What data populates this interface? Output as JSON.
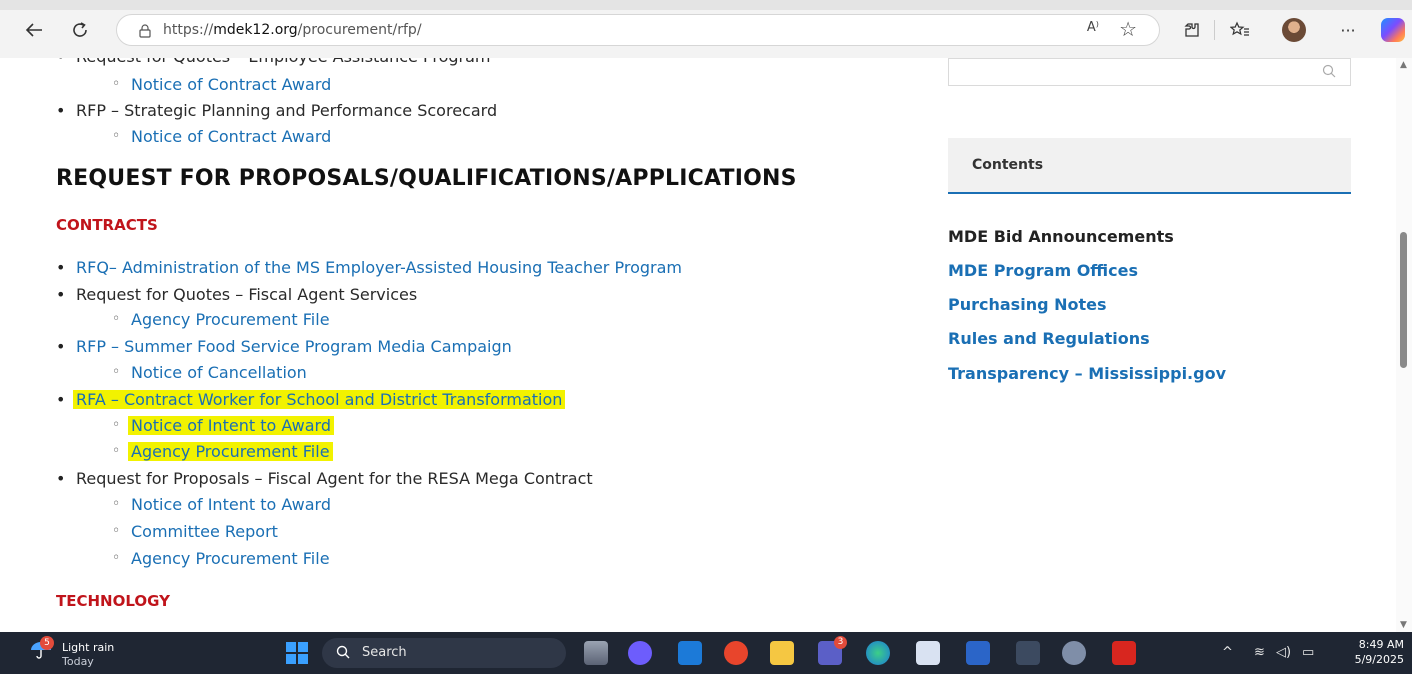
{
  "browser": {
    "url_prefix": "https://",
    "url_domain": "mdek12.org",
    "url_path": "/procurement/rfp/",
    "read_aloud_label": "A⁾"
  },
  "main": {
    "top_items": [
      {
        "title": "Request for Quotes – Employee Assistance Program",
        "sub": [
          "Notice of Contract Award"
        ]
      },
      {
        "title": "RFP – Strategic Planning and Performance Scorecard",
        "sub": [
          "Notice of Contract Award"
        ]
      }
    ],
    "heading": "REQUEST FOR PROPOSALS/QUALIFICATIONS/APPLICATIONS",
    "contracts_label": "CONTRACTS",
    "contract_items": [
      {
        "title": "RFQ– Administration of the MS Employer-Assisted Housing Teacher Program",
        "is_link": true
      },
      {
        "title": "Request for Quotes – Fiscal Agent Services",
        "is_link": false,
        "sub": [
          "Agency Procurement File"
        ]
      },
      {
        "title": "RFP – Summer Food Service Program Media Campaign",
        "is_link": true,
        "sub": [
          "Notice of Cancellation"
        ]
      },
      {
        "title": "RFA – Contract Worker for School and District Transformation",
        "is_link": true,
        "highlighted": true,
        "sub": [
          "Notice of Intent to Award",
          "Agency Procurement File"
        ]
      },
      {
        "title": "Request for Proposals – Fiscal Agent for the RESA Mega Contract",
        "is_link": false,
        "sub": [
          "Notice of Intent to Award",
          "Committee Report",
          "Agency Procurement File"
        ]
      }
    ],
    "technology_label": "TECHNOLOGY"
  },
  "sidebar": {
    "search_placeholder": "",
    "contents_title": "Contents",
    "links": [
      "MDE Bid Announcements",
      "MDE Program Offices",
      "Purchasing Notes",
      "Rules and Regulations",
      "Transparency – Mississippi.gov"
    ]
  },
  "taskbar": {
    "weather_badge": "5",
    "weather_text": "Light rain",
    "weather_sub": "Today",
    "search_label": "Search",
    "teams_badge": "3",
    "time": "8:49 AM",
    "date": "5/9/2025"
  },
  "colors": {
    "link": "#1a6fb4",
    "section_red": "#c0141b",
    "highlight": "#f2f200"
  }
}
